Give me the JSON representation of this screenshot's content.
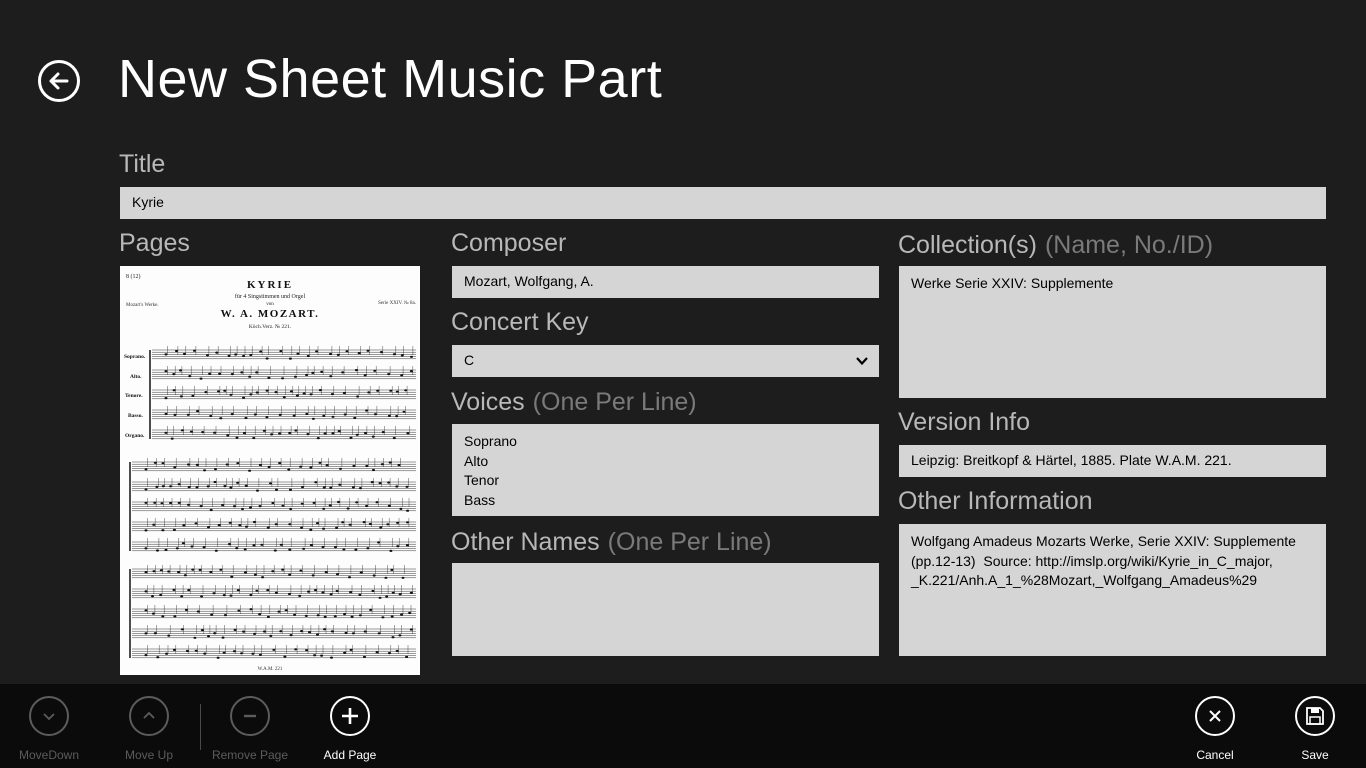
{
  "header": {
    "title": "New Sheet Music Part"
  },
  "labels": {
    "title": "Title",
    "pages": "Pages",
    "composer": "Composer",
    "concert_key": "Concert Key",
    "voices": "Voices",
    "voices_hint": "(One Per Line)",
    "other_names": "Other Names",
    "other_names_hint": "(One Per Line)",
    "collections": "Collection(s)",
    "collections_hint": "(Name, No./ID)",
    "version_info": "Version Info",
    "other_information": "Other Information"
  },
  "fields": {
    "title": "Kyrie",
    "composer": "Mozart, Wolfgang, A.",
    "concert_key": "C",
    "voices": "Soprano\nAlto\nTenor\nBass",
    "other_names": "",
    "collections": "Werke Serie XXIV: Supplemente",
    "version_info": "Leipzig: Breitkopf & Härtel, 1885. Plate W.A.M. 221.",
    "other_information": "Wolfgang Amadeus Mozarts Werke, Serie XXIV: Supplemente\n(pp.12-13)  Source: http://imslp.org/wiki/Kyrie_in_C_major,\n_K.221/Anh.A_1_%28Mozart,_Wolfgang_Amadeus%29"
  },
  "score_page": {
    "page_number": "8 (12)",
    "heading": "KYRIE",
    "subheading": "für 4 Singstimmen und Orgel",
    "von": "von",
    "composer": "W. A. MOZART.",
    "catalog": "Köch.Verz. № 221.",
    "left_note": "Mozart's Werke.",
    "right_note": "Serie XXIV. № 8a.",
    "parts": [
      "Soprano.",
      "Alto.",
      "Tenore.",
      "Basso.",
      "Organo."
    ],
    "plate": "W.A.M. 221"
  },
  "appbar": {
    "move_down": "MoveDown",
    "move_up": "Move Up",
    "remove_page": "Remove Page",
    "add_page": "Add Page",
    "cancel": "Cancel",
    "save": "Save"
  },
  "colors": {
    "background": "#1d1d1d",
    "appbar": "#0b0b0b",
    "field": "#d5d5d5",
    "label": "#b8b8b8",
    "hint": "#7a7a7a"
  }
}
